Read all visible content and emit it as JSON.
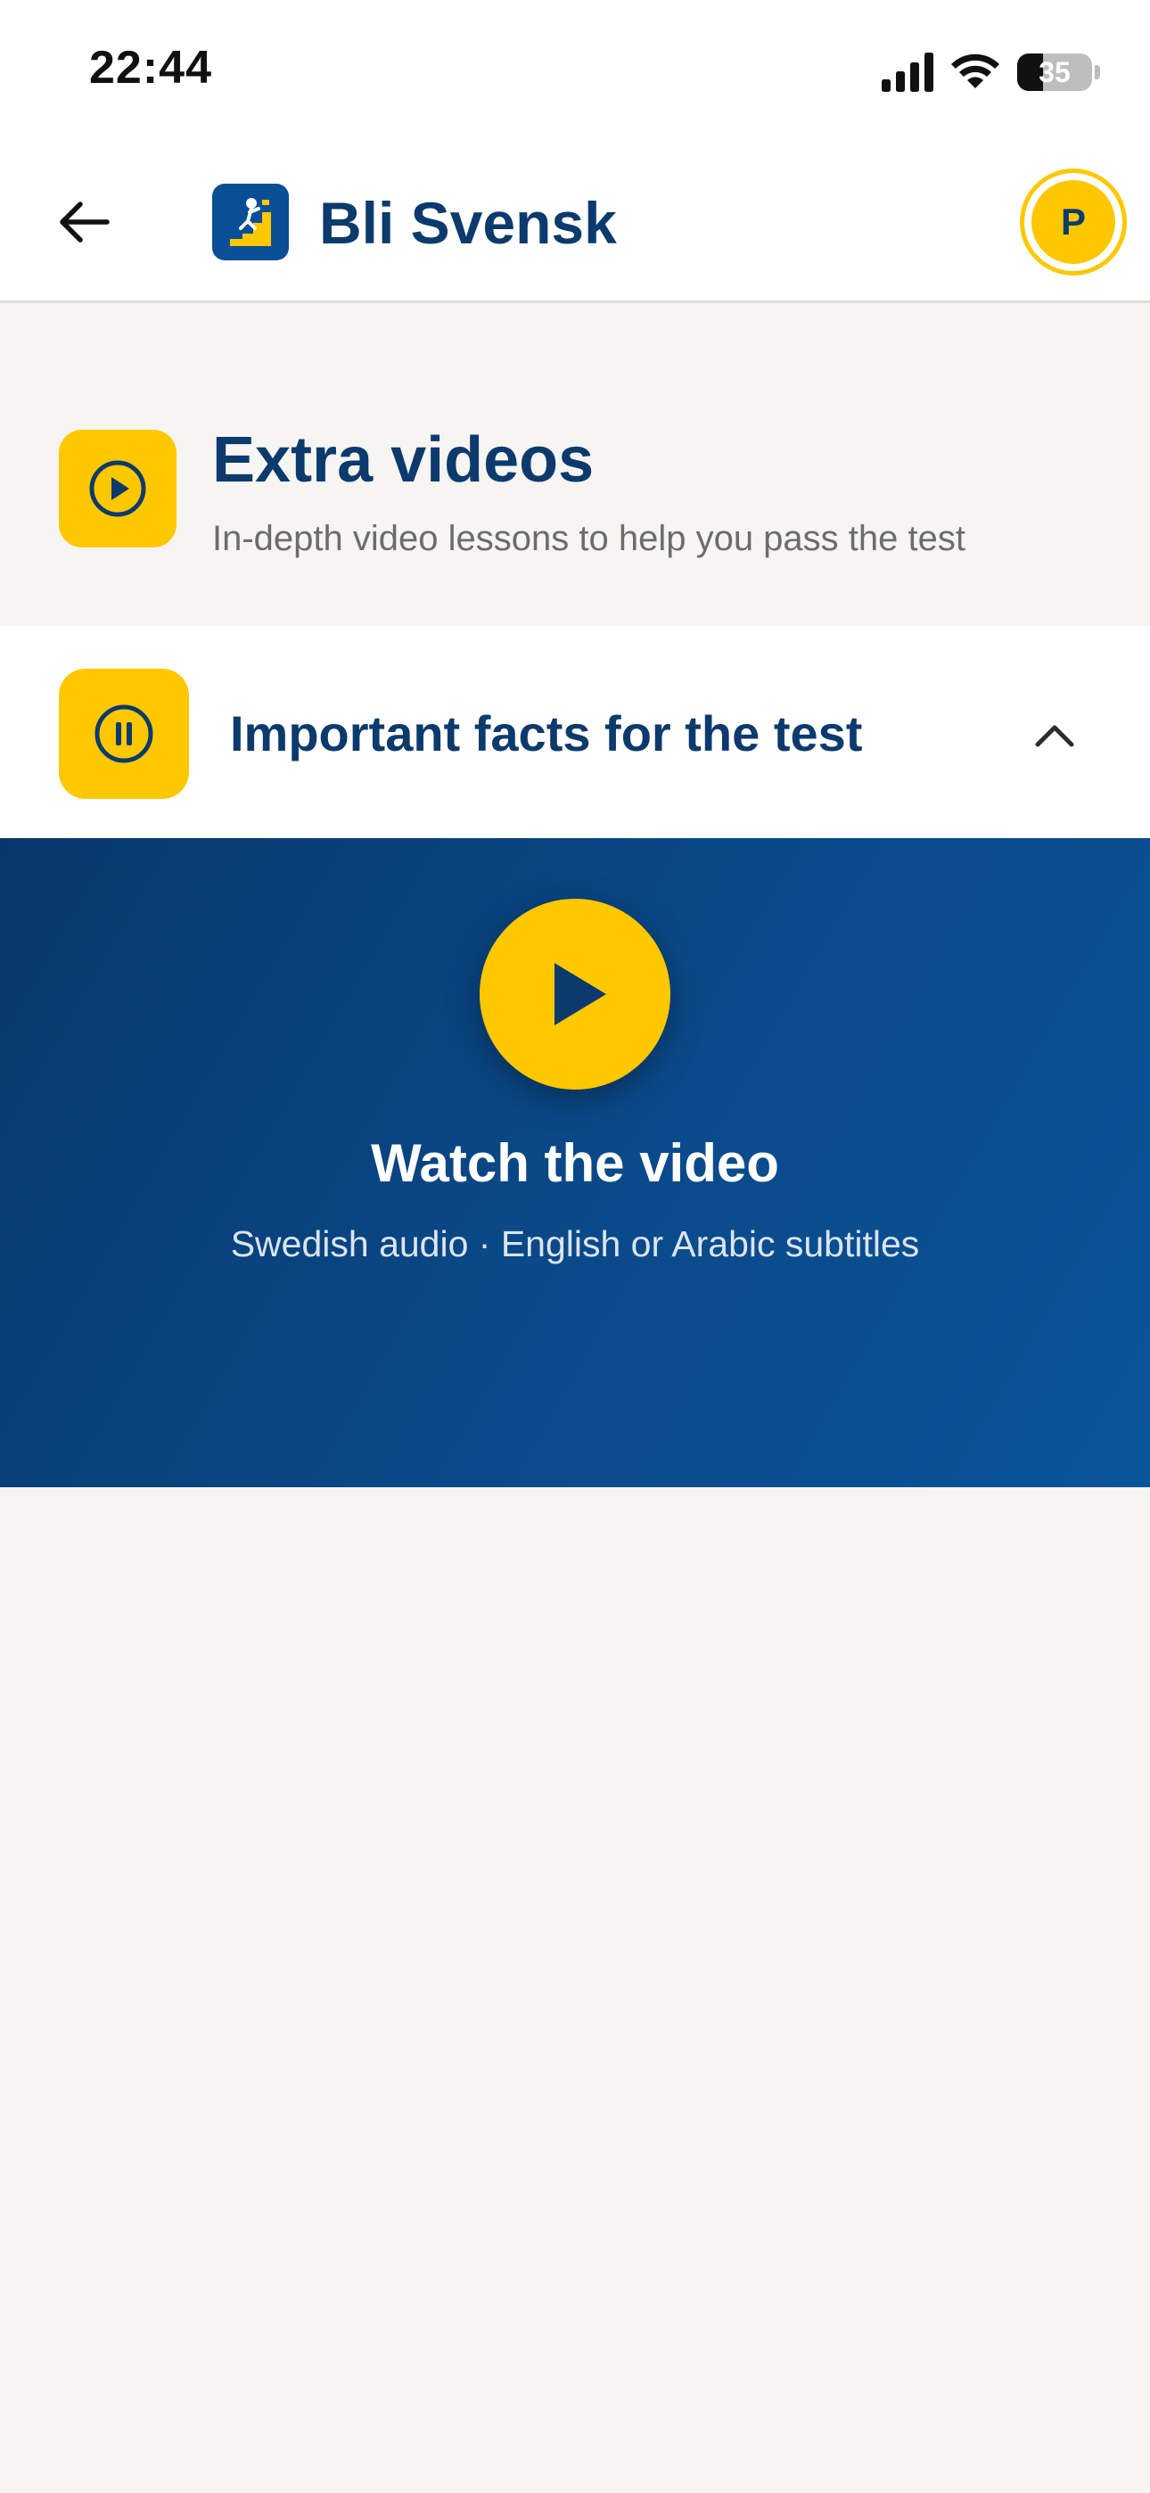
{
  "status_bar": {
    "time": "22:44",
    "battery_level": "35",
    "battery_fraction": 0.35
  },
  "header": {
    "app_name": "Bli Svensk",
    "avatar_initial": "P",
    "icons": {
      "back": "arrow-left-icon",
      "logo": "staircase-climber-icon"
    },
    "colors": {
      "brand_blue": "#0c3a6c",
      "logo_blue": "#0a4f96",
      "accent_yellow": "#fdc800"
    }
  },
  "section": {
    "title": "Extra videos",
    "subtitle": "In-depth video lessons to help you pass the test",
    "icon": "play-circle-icon"
  },
  "accordion": {
    "title": "Important facts for the test",
    "icon": "pause-circle-icon",
    "expanded_icon": "chevron-up-icon"
  },
  "video": {
    "title": "Watch the video",
    "subtitle": "Swedish audio · English or Arabic subtitles",
    "play_icon": "play-icon",
    "colors": {
      "panel_start": "#08386b",
      "panel_end": "#0a5499"
    }
  }
}
